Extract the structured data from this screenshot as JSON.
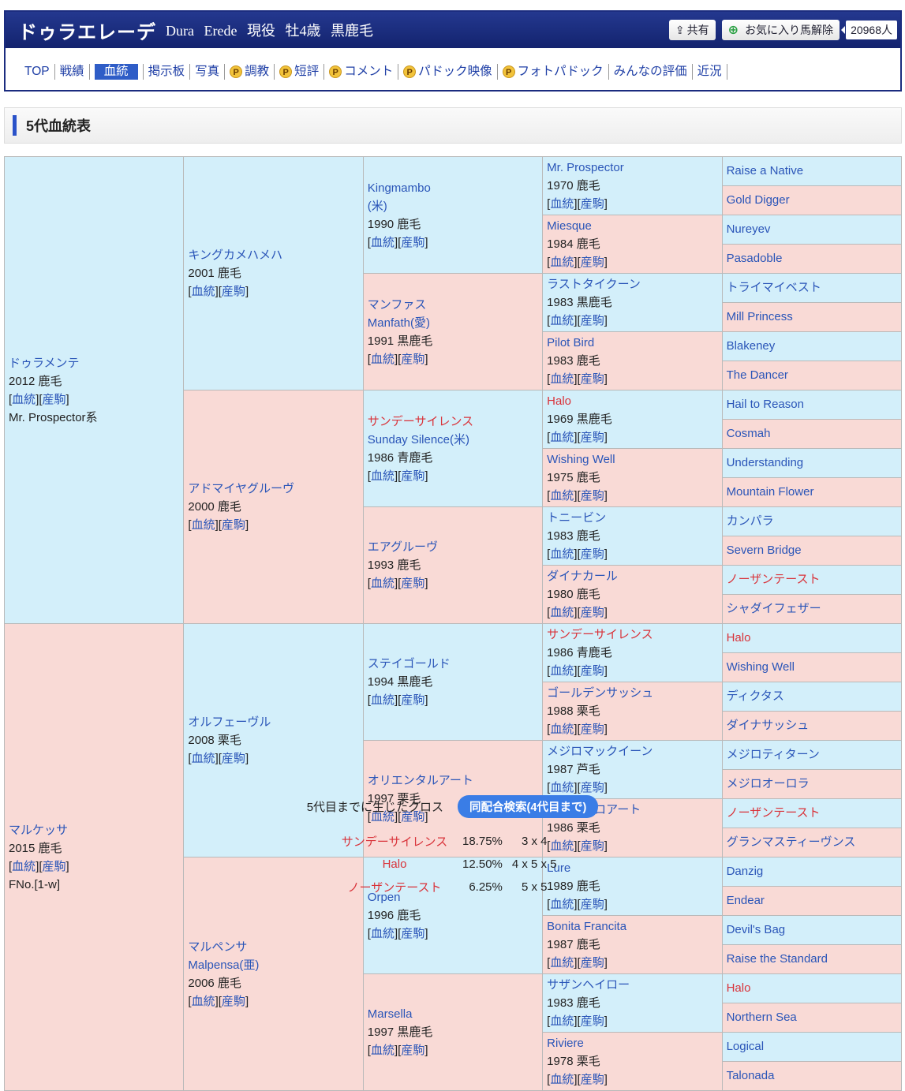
{
  "header": {
    "name": "ドゥラエレーデ",
    "subtitle": "Dura Erede 現役 牡4歳 黒鹿毛",
    "share": "共有",
    "favorite": "お気に入り馬解除",
    "fav_count": "20968人"
  },
  "nav": [
    {
      "label": "TOP"
    },
    {
      "label": "戦績"
    },
    {
      "label": "血統",
      "active": true
    },
    {
      "label": "掲示板"
    },
    {
      "label": "写真"
    },
    {
      "label": "調教",
      "p": true
    },
    {
      "label": "短評",
      "p": true
    },
    {
      "label": "コメント",
      "p": true
    },
    {
      "label": "パドック映像",
      "p": true
    },
    {
      "label": "フォトパドック",
      "p": true
    },
    {
      "label": "みんなの評価"
    },
    {
      "label": "近況"
    }
  ],
  "p_badge": "P",
  "section_title": "5代血統表",
  "links": {
    "pedigree": "血統",
    "progeny": "産駒"
  },
  "pedigree": {
    "gen1": [
      {
        "name": "ドゥラメンテ",
        "info": "2012 鹿毛",
        "extra": "Mr. Prospector系"
      },
      {
        "name": "マルケッサ",
        "info": "2015 鹿毛",
        "extra": "FNo.[1-w]"
      }
    ],
    "gen2": [
      {
        "name": "キングカメハメハ",
        "info": "2001 鹿毛"
      },
      {
        "name": "アドマイヤグルーヴ",
        "info": "2000 鹿毛"
      },
      {
        "name": "オルフェーヴル",
        "info": "2008 栗毛"
      },
      {
        "name": "マルペンサ",
        "name2": "Malpensa(亜)",
        "info": "2006 鹿毛"
      }
    ],
    "gen3": [
      {
        "name": "Kingmambo",
        "name2": "(米)",
        "info": "1990 鹿毛"
      },
      {
        "name": "マンファス",
        "name2": "Manfath(愛)",
        "info": "1991 黒鹿毛"
      },
      {
        "name": "サンデーサイレンス",
        "red": true,
        "name2": "Sunday Silence(米)",
        "info": "1986 青鹿毛"
      },
      {
        "name": "エアグルーヴ",
        "info": "1993 鹿毛"
      },
      {
        "name": "ステイゴールド",
        "info": "1994 黒鹿毛"
      },
      {
        "name": "オリエンタルアート",
        "info": "1997 栗毛"
      },
      {
        "name": "Orpen",
        "info": "1996 鹿毛"
      },
      {
        "name": "Marsella",
        "info": "1997 黒鹿毛"
      }
    ],
    "gen4": [
      {
        "name": "Mr. Prospector",
        "info": "1970 鹿毛"
      },
      {
        "name": "Miesque",
        "info": "1984 鹿毛"
      },
      {
        "name": "ラストタイクーン",
        "info": "1983 黒鹿毛"
      },
      {
        "name": "Pilot Bird",
        "info": "1983 鹿毛"
      },
      {
        "name": "Halo",
        "red": true,
        "info": "1969 黒鹿毛"
      },
      {
        "name": "Wishing Well",
        "info": "1975 鹿毛"
      },
      {
        "name": "トニービン",
        "info": "1983 鹿毛"
      },
      {
        "name": "ダイナカール",
        "info": "1980 鹿毛"
      },
      {
        "name": "サンデーサイレンス",
        "red": true,
        "info": "1986 青鹿毛"
      },
      {
        "name": "ゴールデンサッシュ",
        "info": "1988 栗毛"
      },
      {
        "name": "メジロマックイーン",
        "info": "1987 芦毛"
      },
      {
        "name": "エレクトロアート",
        "info": "1986 栗毛"
      },
      {
        "name": "Lure",
        "info": "1989 鹿毛"
      },
      {
        "name": "Bonita Francita",
        "info": "1987 鹿毛"
      },
      {
        "name": "サザンヘイロー",
        "info": "1983 鹿毛"
      },
      {
        "name": "Riviere",
        "info": "1978 栗毛"
      }
    ],
    "gen5": [
      {
        "name": "Raise a Native"
      },
      {
        "name": "Gold Digger"
      },
      {
        "name": "Nureyev"
      },
      {
        "name": "Pasadoble"
      },
      {
        "name": "トライマイベスト"
      },
      {
        "name": "Mill Princess"
      },
      {
        "name": "Blakeney"
      },
      {
        "name": "The Dancer"
      },
      {
        "name": "Hail to Reason"
      },
      {
        "name": "Cosmah"
      },
      {
        "name": "Understanding"
      },
      {
        "name": "Mountain Flower"
      },
      {
        "name": "カンパラ"
      },
      {
        "name": "Severn Bridge"
      },
      {
        "name": "ノーザンテースト",
        "red": true
      },
      {
        "name": "シャダイフェザー"
      },
      {
        "name": "Halo",
        "red": true
      },
      {
        "name": "Wishing Well"
      },
      {
        "name": "ディクタス"
      },
      {
        "name": "ダイナサッシュ"
      },
      {
        "name": "メジロティターン"
      },
      {
        "name": "メジロオーロラ"
      },
      {
        "name": "ノーザンテースト",
        "red": true
      },
      {
        "name": "グランマスティーヴンス"
      },
      {
        "name": "Danzig"
      },
      {
        "name": "Endear"
      },
      {
        "name": "Devil's Bag"
      },
      {
        "name": "Raise the Standard"
      },
      {
        "name": "Halo",
        "red": true
      },
      {
        "name": "Northern Sea"
      },
      {
        "name": "Logical"
      },
      {
        "name": "Talonada"
      }
    ]
  },
  "cross": {
    "label": "5代目までに生じたクロス",
    "search_button": "同配合検索(4代目まで)",
    "rows": [
      {
        "name": "サンデーサイレンス",
        "pct": "18.75%",
        "gen": "3 x 4"
      },
      {
        "name": "Halo",
        "pct": "12.50%",
        "gen": "4 x 5 x 5"
      },
      {
        "name": "ノーザンテースト",
        "pct": "6.25%",
        "gen": "5 x 5"
      }
    ]
  },
  "colors": {
    "male": "#d3effa",
    "female": "#f9dad6",
    "cross": "#d9333a",
    "link": "#2a55b8",
    "header": "#1b2c7f"
  }
}
